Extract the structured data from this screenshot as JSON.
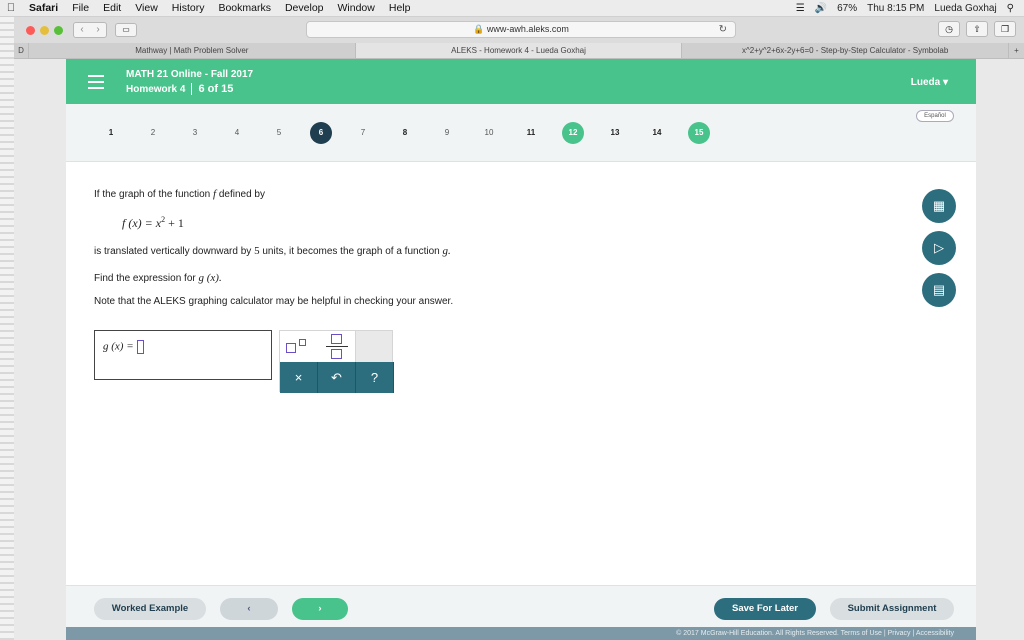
{
  "menubar": {
    "app": "Safari",
    "items": [
      "File",
      "Edit",
      "View",
      "History",
      "Bookmarks",
      "Develop",
      "Window",
      "Help"
    ],
    "battery": "67%",
    "clock": "Thu 8:15 PM",
    "user": "Lueda Goxhaj"
  },
  "browser": {
    "url": "www-awh.aleks.com",
    "tabs": [
      "Mathway | Math Problem Solver",
      "ALEKS - Homework 4 - Lueda Goxhaj",
      "x^2+y^2+6x-2y+6=0 - Step-by-Step Calculator - Symbolab"
    ],
    "active_tab": 1
  },
  "header": {
    "course": "MATH 21 Online - Fall 2017",
    "homework": "Homework 4",
    "progress": "6 of 15",
    "user": "Lueda",
    "language": "Español"
  },
  "question_nav": [
    {
      "n": "1",
      "state": "done"
    },
    {
      "n": "2",
      "state": "todo"
    },
    {
      "n": "3",
      "state": "todo"
    },
    {
      "n": "4",
      "state": "todo"
    },
    {
      "n": "5",
      "state": "todo"
    },
    {
      "n": "6",
      "state": "current"
    },
    {
      "n": "7",
      "state": "todo"
    },
    {
      "n": "8",
      "state": "done"
    },
    {
      "n": "9",
      "state": "todo"
    },
    {
      "n": "10",
      "state": "todo"
    },
    {
      "n": "11",
      "state": "done"
    },
    {
      "n": "12",
      "state": "green"
    },
    {
      "n": "13",
      "state": "done"
    },
    {
      "n": "14",
      "state": "done"
    },
    {
      "n": "15",
      "state": "green"
    }
  ],
  "problem": {
    "line1a": "If the graph of the function",
    "line1f": "f",
    "line1b": "defined by",
    "formula_lhs": "f (x) = x",
    "formula_exp": "2",
    "formula_rhs": " + 1",
    "line2a": "is translated vertically downward by",
    "line2n": "5",
    "line2b": "units, it becomes the graph of a function",
    "line2g": "g.",
    "line3a": "Find the expression for",
    "line3g": "g (x).",
    "line4": "Note that the ALEKS graphing calculator may be helpful in checking your answer."
  },
  "answer": {
    "label": "g (x) ="
  },
  "keypad": {
    "clear": "×",
    "undo": "↶",
    "help": "?"
  },
  "footer": {
    "worked_example": "Worked Example",
    "prev": "‹",
    "next": "›",
    "save": "Save For Later",
    "submit": "Submit Assignment",
    "copyright": "© 2017 McGraw-Hill Education. All Rights Reserved.   Terms of Use  |  Privacy  |  Accessibility"
  },
  "colors": {
    "header": "#48c38c",
    "dark": "#1f3e4f",
    "teal": "#2d6e7e"
  }
}
